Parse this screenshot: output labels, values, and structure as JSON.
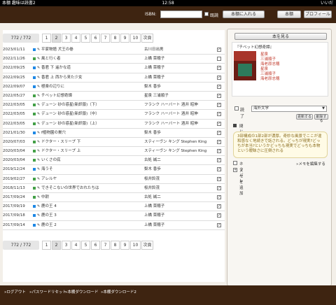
{
  "status_bar": {
    "left": "本棚 趣味は読書2",
    "time": "12:58",
    "right": "いいだ"
  },
  "header": {
    "isbn_label": "ISBN:",
    "isbn_value": "",
    "read_label": "既読",
    "add_button": "本棚に入れる",
    "shelf_button": "本棚",
    "profile_button": "プロフィール"
  },
  "pager": {
    "count": "772 / 772",
    "pages": [
      "1",
      "2",
      "3",
      "4",
      "5",
      "6",
      "7",
      "8",
      "9",
      "10"
    ],
    "current": "2",
    "next": "次頁"
  },
  "rows": [
    {
      "date": "2023/01/11",
      "color": "#1e88e5",
      "title": "平家物語 犬王の巻",
      "author": "古川日出男",
      "read": true
    },
    {
      "date": "2022/11/26",
      "color": "#43a047",
      "title": "風と行く者",
      "author": "上橋 菜穂子",
      "read": false
    },
    {
      "date": "2022/09/25",
      "color": "#1e88e5",
      "title": "香君 下 遥かな道",
      "author": "上橋 菜穂子",
      "read": true
    },
    {
      "date": "2022/09/25",
      "color": "#1e88e5",
      "title": "香君 上 西から来た少女",
      "author": "上橋 菜穂子",
      "read": true
    },
    {
      "date": "2022/09/07",
      "color": "#1e88e5",
      "title": "極楽の辺りに",
      "author": "梨木 香歩",
      "read": true
    },
    {
      "date": "2022/05/27",
      "color": "#43a047",
      "title": "チベット幻想奇譚",
      "author": "星泉 三浦順子",
      "read": true
    },
    {
      "date": "2022/03/05",
      "color": "#43a047",
      "title": "デューン 砂の惑星(新訳版)（下）",
      "author": "フランク ハーバート 酒井 昭伸",
      "read": true
    },
    {
      "date": "2022/03/05",
      "color": "#43a047",
      "title": "デューン 砂の惑星(新訳版)（中）",
      "author": "フランク ハーバート 酒井 昭伸",
      "read": true
    },
    {
      "date": "2022/03/05",
      "color": "#43a047",
      "title": "デューン 砂の惑星(新訳版)（上）",
      "author": "フランク ハーバート 酒井 昭伸",
      "read": true
    },
    {
      "date": "2021/01/30",
      "color": "#1e88e5",
      "title": "f植物園の巣穴",
      "author": "梨木 香歩",
      "read": true
    },
    {
      "date": "2020/07/03",
      "color": "#43a047",
      "title": "ドクター・スリープ 下",
      "author": "スティーヴン キング Stephen King",
      "read": true
    },
    {
      "date": "2020/03/04",
      "color": "#43a047",
      "title": "ドクター・スリープ 上",
      "author": "スティーヴン キング Stephen King",
      "read": true
    },
    {
      "date": "2020/03/04",
      "color": "#43a047",
      "title": "いくさの底",
      "author": "古処 誠二",
      "read": true
    },
    {
      "date": "2019/12/24",
      "color": "#1e88e5",
      "title": "海うそ",
      "author": "梨木 香歩",
      "read": true
    },
    {
      "date": "2019/02/27",
      "color": "#43a047",
      "title": "アレルヤ",
      "author": "桜井鈴茂",
      "read": true
    },
    {
      "date": "2018/11/13",
      "color": "#43a047",
      "title": "できそこないの世界でおれたちは",
      "author": "桜井鈴茂",
      "read": true
    },
    {
      "date": "2017/09/24",
      "color": "#43a047",
      "title": "中尉",
      "author": "古処 誠二",
      "read": true
    },
    {
      "date": "2017/09/19",
      "color": "#1e88e5",
      "title": "鹿の王 4",
      "author": "上橋 菜穂子",
      "read": true
    },
    {
      "date": "2017/09/18",
      "color": "#1e88e5",
      "title": "鹿の王 3",
      "author": "上橋 菜穂子",
      "read": true
    },
    {
      "date": "2017/09/14",
      "color": "#1e88e5",
      "title": "鹿の王 2",
      "author": "上橋 菜穂子",
      "read": true
    }
  ],
  "detail": {
    "view_book": "本を見る",
    "title": "『チベット幻想奇譚』",
    "info": [
      "星泉",
      "三浦順子",
      "海老原志穂",
      "星泉",
      "三浦順子",
      "海老原志穂"
    ],
    "read_label": "読了",
    "genre": "海外文学",
    "update_button": "更新する",
    "delete_button": "削除する",
    "close_label": "閉じる",
    "memo": "3部構成の1部2部が濃厚。奇妙な風景でここが違和感なく地続きで話される。どっちが現実?どっちが本当?というかどっちも現実でどっちも本物という曖昧さに圧倒される",
    "spoiler_label": "ネタバレ",
    "edit_memo": "»メモを編集する",
    "add_memo": "メモを追加"
  },
  "footer": {
    "logout": "»ログアウト",
    "pw_reset": "»パスワードリセット",
    "download": "»本棚ダウンロード",
    "download2": "»本棚ダウンロード2"
  }
}
